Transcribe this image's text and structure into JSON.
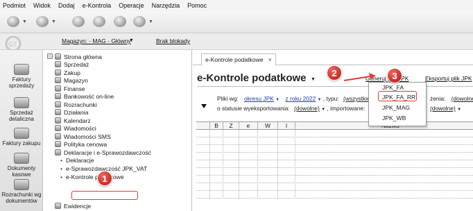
{
  "menu": [
    "Podmiot",
    "Widok",
    "Dodaj",
    "e-Kontrola",
    "Operacje",
    "Narzędzia",
    "Pomoc"
  ],
  "subbar": {
    "magazyn": "Magazyn: - MAG - Główny",
    "brak_blokady": "Brak blokady"
  },
  "left_bar": [
    {
      "label": "Faktury sprzedaży"
    },
    {
      "label": "Sprzedaż detaliczna"
    },
    {
      "label": "Faktury zakupu"
    },
    {
      "label": "Dokumenty kasowe"
    },
    {
      "label": "Rozrachunki wg dokumentów"
    }
  ],
  "tree": [
    "Strona główna",
    "Sprzedaż",
    "Zakup",
    "Magazyn",
    "Finanse",
    "Bankowość on-line",
    "Rozrachunki",
    "Działania",
    "Kalendarz",
    "Wiadomości",
    "Wiadomości SMS",
    "Polityka cenowa",
    "Deklaracje i e-Sprawozdawczość"
  ],
  "tree_sub": [
    "Deklaracje",
    "e-Sprawozdawczość JPK_VAT",
    "e-Kontrole podatkowe"
  ],
  "tree_after": "Ewidencje",
  "tab": {
    "label": "e-Kontrole podatkowe",
    "close": "×"
  },
  "heading": "e-Kontrole podatkowe",
  "links": {
    "generuj": "Generuj plik JPK",
    "eksportuj": "Eksportuj plik JPK"
  },
  "filters": {
    "pliki_wg": "Pliki wg:",
    "okresu": "okresu JPK",
    "rok": "z roku 2022",
    "typu": ", typu:",
    "wszystkie": "(wszystkie)",
    "zenia": "żenia:",
    "dowolne1": "(dowolne)",
    "status_label": "o statusie wyeksportowania:",
    "dowolne2": "(dowolne)",
    "importowane": ", importowane:",
    "dowolne3": "(dowolne)"
  },
  "grid": {
    "columns": [
      "B",
      "Z",
      "e",
      "W",
      "I"
    ],
    "nazwa": "Nazwa"
  },
  "dropdown": [
    "JPK_FA",
    "JPK_FA_RR",
    "JPK_MAG",
    "JPK_WB"
  ],
  "badges": [
    "1",
    "2",
    "3"
  ],
  "colors": {
    "accent_red": "#e13a34",
    "link_blue": "#1740b3"
  }
}
